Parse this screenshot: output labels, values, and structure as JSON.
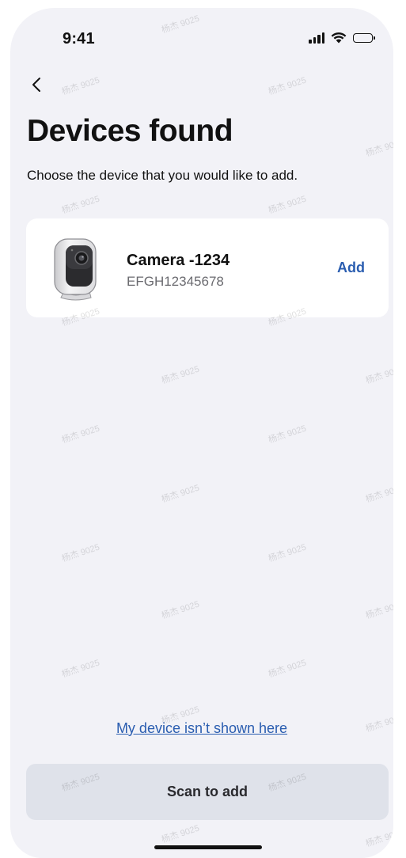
{
  "status_bar": {
    "time": "9:41",
    "icons": [
      "signal-icon",
      "wifi-icon",
      "battery-icon"
    ]
  },
  "navigation": {
    "back_icon": "chevron-left-icon",
    "title": "Devices found",
    "subtitle": "Choose the device that you would like to add."
  },
  "device": {
    "name": "Camera -1234",
    "serial": "EFGH12345678",
    "image_icon": "security-camera-icon",
    "add_label": "Add"
  },
  "footer": {
    "help_link": "My device isn’t shown here",
    "scan_label": "Scan to add"
  },
  "watermark_text": "杨杰 9025",
  "colors": {
    "background": "#f2f2f7",
    "card": "#ffffff",
    "accent": "#2a5db0",
    "secondary_button": "#dfe2ea"
  }
}
